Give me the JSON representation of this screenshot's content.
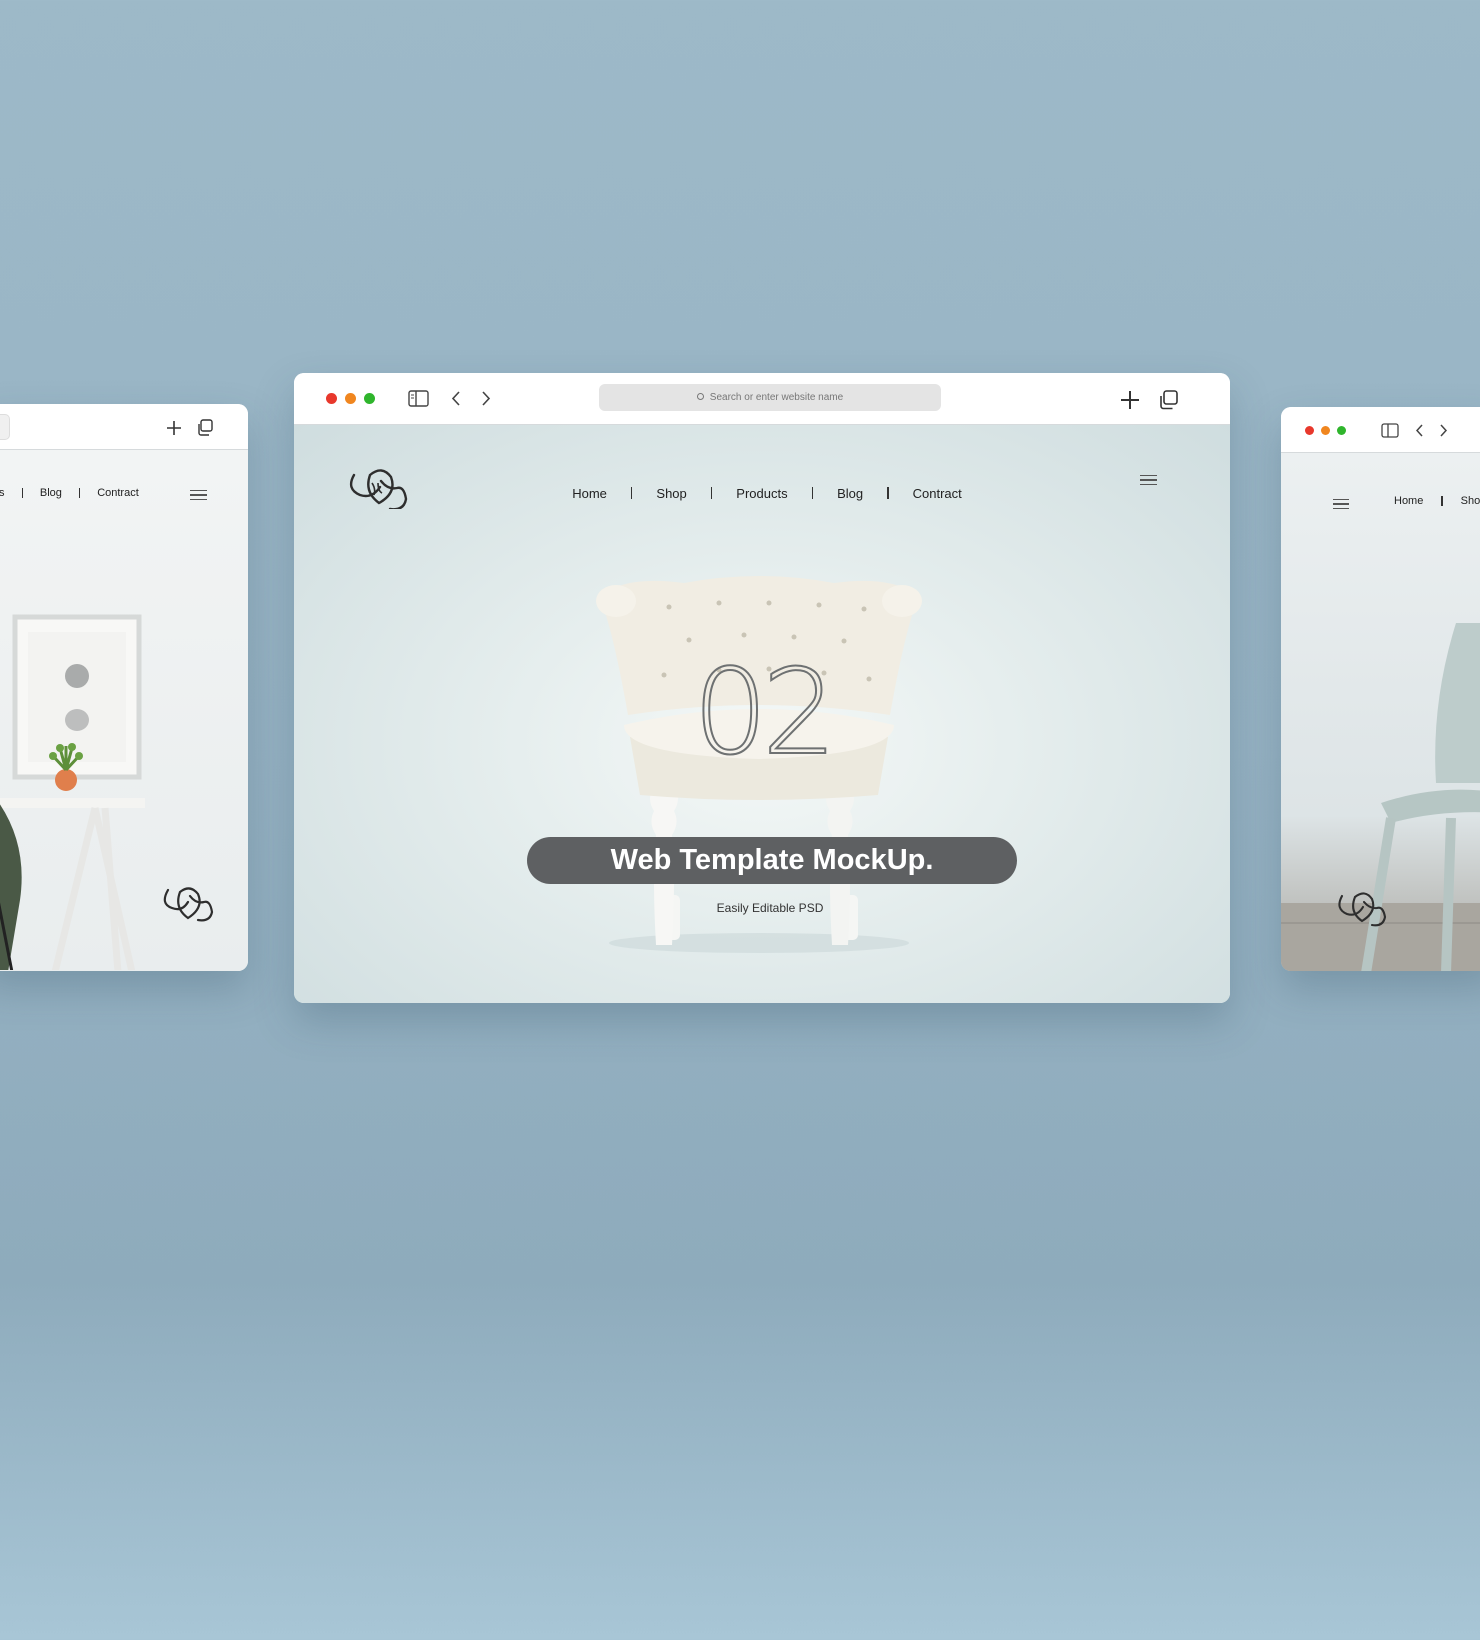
{
  "main_window": {
    "url_placeholder": "Search or enter website name",
    "nav": [
      "Home",
      "Shop",
      "Products",
      "Blog",
      "Contract"
    ],
    "hero_number": "02",
    "hero_title": "Web Template MockUp.",
    "hero_subtitle": "Easily Editable PSD",
    "traffic_lights": [
      "#e8382c",
      "#f0861f",
      "#2fb52c"
    ]
  },
  "left_window": {
    "nav_partial": [
      "ts",
      "Blog",
      "Contract"
    ]
  },
  "right_window": {
    "nav_partial": [
      "Home",
      "Sho"
    ],
    "traffic_lights": [
      "#e8382c",
      "#f0861f",
      "#2fb52c"
    ]
  },
  "icons": [
    "sidebar-icon",
    "back-chevron-icon",
    "forward-chevron-icon",
    "new-tab-plus-icon",
    "tabs-overview-icon",
    "search-icon",
    "hamburger-menu-icon",
    "brand-logo"
  ]
}
